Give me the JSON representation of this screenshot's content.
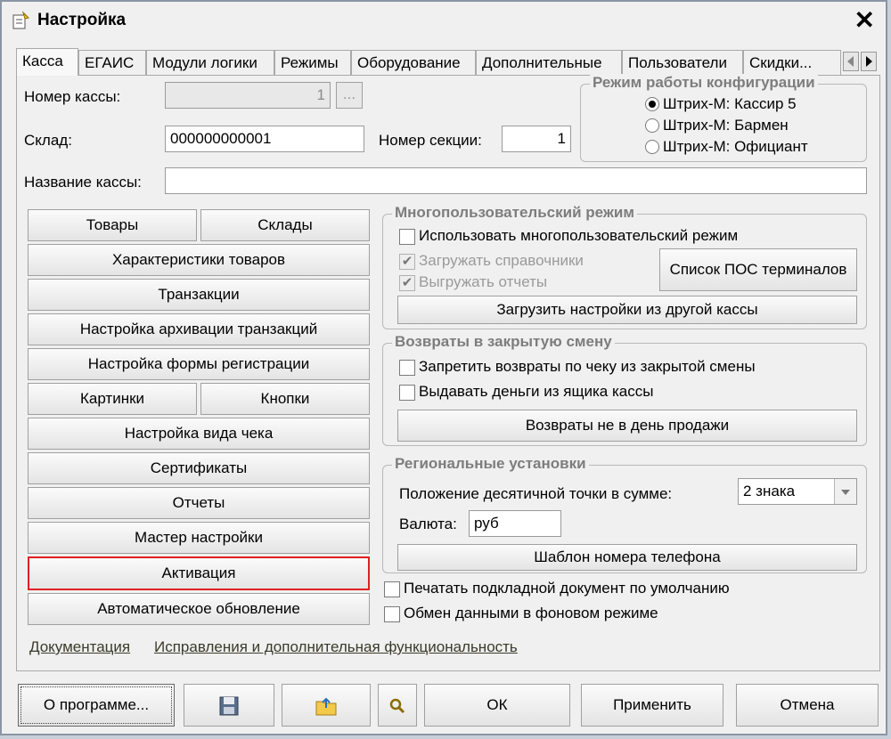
{
  "window": {
    "title": "Настройка"
  },
  "tabs": [
    "Касса",
    "ЕГАИС",
    "Модули логики",
    "Режимы",
    "Оборудование",
    "Дополнительные",
    "Пользователи",
    "Скидки..."
  ],
  "form": {
    "kassa_number_label": "Номер кассы:",
    "kassa_number_value": "1",
    "browse_label": "...",
    "sklad_label": "Склад:",
    "sklad_value": "000000000001",
    "section_label": "Номер секции:",
    "section_value": "1",
    "kassa_name_label": "Название кассы:",
    "kassa_name_value": ""
  },
  "mode_group": {
    "title": "Режим работы конфигурации",
    "options": [
      "Штрих-М: Кассир 5",
      "Штрих-М: Бармен",
      "Штрих-М: Официант"
    ],
    "selected": 0
  },
  "left_buttons": {
    "goods": "Товары",
    "warehouses": "Склады",
    "goods_chars": "Характеристики товаров",
    "transactions": "Транзакции",
    "archive": "Настройка архивации транзакций",
    "reg_form": "Настройка формы регистрации",
    "pictures": "Картинки",
    "buttons": "Кнопки",
    "receipt_view": "Настройка вида чека",
    "certificates": "Сертификаты",
    "reports": "Отчеты",
    "wizard": "Мастер настройки",
    "activation": "Активация",
    "auto_update": "Автоматическое обновление"
  },
  "multiuser": {
    "title": "Многопользовательский режим",
    "use_label": "Использовать многопользовательский режим",
    "load_refs": "Загружать справочники",
    "unload_reports": "Выгружать отчеты",
    "pos_list": "Список ПОС терминалов",
    "load_settings": "Загрузить настройки из другой кассы"
  },
  "returns": {
    "title": "Возвраты в закрытую смену",
    "forbid_label": "Запретить возвраты по чеку из закрытой смены",
    "cash_label": "Выдавать деньги из ящика кассы",
    "not_sale_day": "Возвраты не в день продажи"
  },
  "regional": {
    "title": "Региональные установки",
    "decimal_label": "Положение десятичной точки в сумме:",
    "decimal_value": "2 знака",
    "currency_label": "Валюта:",
    "currency_value": "руб",
    "phone_template": "Шаблон номера телефона"
  },
  "misc": {
    "print_doc_label": "Печатать подкладной документ по умолчанию",
    "bg_exchange_label": "Обмен данными в фоновом режиме"
  },
  "links": {
    "docs": "Документация",
    "fixes": "Исправления и дополнительная функциональность"
  },
  "footer": {
    "about": "О программе...",
    "ok": "ОК",
    "apply": "Применить",
    "cancel": "Отмена"
  }
}
